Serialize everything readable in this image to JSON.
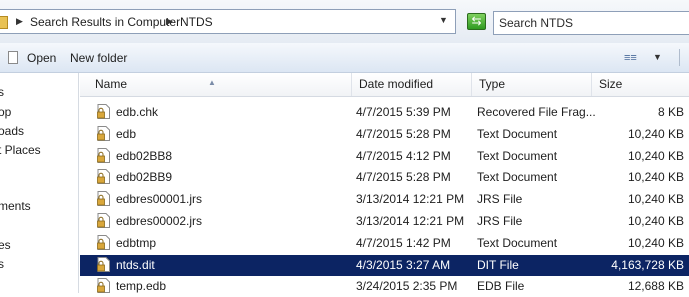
{
  "address": {
    "crumbs": [
      "Search Results in Computer",
      "NTDS"
    ],
    "search_placeholder": "Search NTDS"
  },
  "toolbar": {
    "open_label": "Open",
    "new_folder_label": "New folder"
  },
  "nav": {
    "items": [
      "s",
      "op",
      "oads",
      "t Places",
      "",
      "ments",
      "",
      "es",
      "s"
    ]
  },
  "columns": {
    "name": "Name",
    "date": "Date modified",
    "type": "Type",
    "size": "Size"
  },
  "files": [
    {
      "name": "edb.chk",
      "date": "4/7/2015 5:39 PM",
      "type": "Recovered File Frag...",
      "size": "8 KB",
      "selected": false
    },
    {
      "name": "edb",
      "date": "4/7/2015 5:28 PM",
      "type": "Text Document",
      "size": "10,240 KB",
      "selected": false
    },
    {
      "name": "edb02BB8",
      "date": "4/7/2015 4:12 PM",
      "type": "Text Document",
      "size": "10,240 KB",
      "selected": false
    },
    {
      "name": "edb02BB9",
      "date": "4/7/2015 5:28 PM",
      "type": "Text Document",
      "size": "10,240 KB",
      "selected": false
    },
    {
      "name": "edbres00001.jrs",
      "date": "3/13/2014 12:21 PM",
      "type": "JRS File",
      "size": "10,240 KB",
      "selected": false
    },
    {
      "name": "edbres00002.jrs",
      "date": "3/13/2014 12:21 PM",
      "type": "JRS File",
      "size": "10,240 KB",
      "selected": false
    },
    {
      "name": "edbtmp",
      "date": "4/7/2015 1:42 PM",
      "type": "Text Document",
      "size": "10,240 KB",
      "selected": false
    },
    {
      "name": "ntds.dit",
      "date": "4/3/2015 3:27 AM",
      "type": "DIT File",
      "size": "4,163,728 KB",
      "selected": true
    },
    {
      "name": "temp.edb",
      "date": "3/24/2015 2:35 PM",
      "type": "EDB File",
      "size": "12,688 KB",
      "selected": false
    }
  ]
}
